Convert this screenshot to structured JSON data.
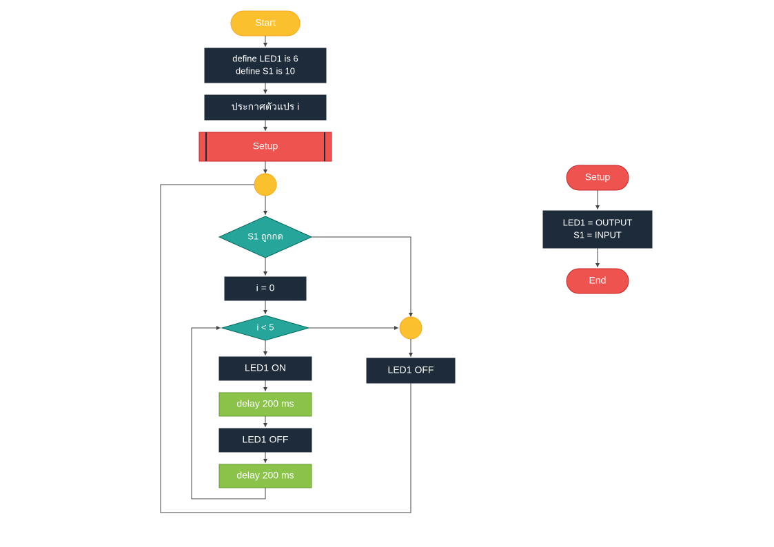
{
  "colors": {
    "dark": "#1d2b3a",
    "green": "#8bc34a",
    "red": "#ef5350",
    "yellow": "#fbc02d",
    "teal": "#26a69a",
    "line": "#444444"
  },
  "main": {
    "start": "Start",
    "define1": "define LED1 is 6",
    "define2": "define S1 is 10",
    "declare_i": "ประกาศตัวแปร i",
    "setup": "Setup",
    "dec_s1": "S1 ถูกกด",
    "i_zero": "i = 0",
    "dec_i5": "i < 5",
    "led_on": "LED1 ON",
    "delay1": "delay 200 ms",
    "led_off_loop": "LED1 OFF",
    "delay2": "delay 200 ms",
    "led_off_right": "LED1 OFF"
  },
  "sub": {
    "setup": "Setup",
    "l1": "LED1 = OUTPUT",
    "l2": "S1 = INPUT",
    "end": "End"
  }
}
